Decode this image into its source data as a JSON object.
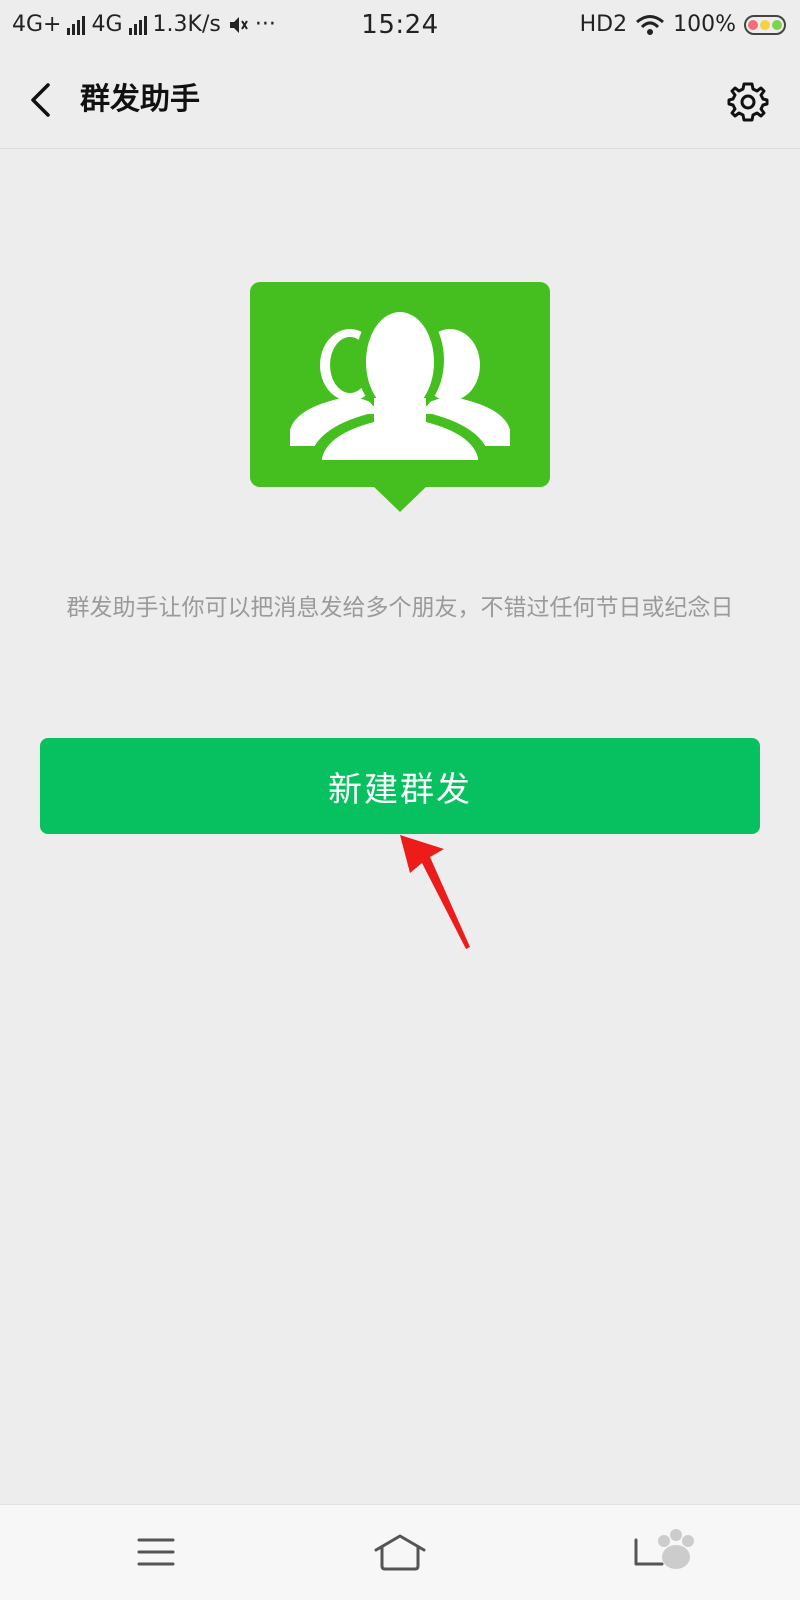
{
  "status_bar": {
    "network1": "4G+",
    "network2": "4G",
    "speed": "1.3K/s",
    "more": "···",
    "time": "15:24",
    "hd": "HD2",
    "battery": "100%"
  },
  "nav": {
    "title": "群发助手"
  },
  "main": {
    "description": "群发助手让你可以把消息发给多个朋友，不错过任何节日或纪念日",
    "button_label": "新建群发"
  },
  "colors": {
    "hero_green": "#45bf1f",
    "button_green": "#07c160",
    "arrow_red": "#ee1b1b"
  },
  "bottom_bar": {
    "icons": [
      "menu-icon",
      "home-icon",
      "back-icon"
    ]
  }
}
